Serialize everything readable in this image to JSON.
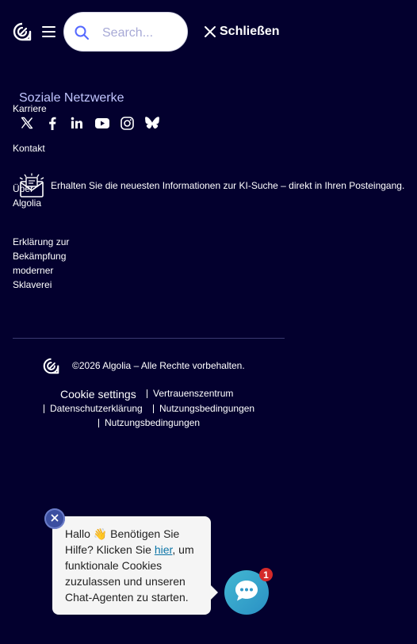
{
  "header": {
    "search_placeholder": "Search...",
    "close_label": "Schließen"
  },
  "menu": {
    "careers": "Karriere",
    "contact": "Kontakt",
    "about": "Über Algolia",
    "slavery_statement": "Erklärung zur Bekämpfung moderner Sklaverei"
  },
  "social": {
    "title": "Soziale Netzwerke",
    "icons": [
      "x-icon",
      "facebook-icon",
      "linkedin-icon",
      "youtube-icon",
      "instagram-icon",
      "bluesky-icon"
    ]
  },
  "newsletter": {
    "text": "Erhalten Sie die neuesten Informationen zur KI-Suche – direkt in Ihren Posteingang."
  },
  "footer": {
    "copyright": "©2026 Algolia – Alle Rechte vorbehalten.",
    "cookie_settings": "Cookie settings",
    "trust_center": "Vertrauenszentrum",
    "privacy": "Datenschutzerklärung",
    "terms_1": "Nutzungsbedingungen",
    "terms_2": "Nutzungsbedingungen"
  },
  "chat": {
    "greeting": "Hallo",
    "wave_emoji": "👋",
    "text_before_link": "Benötigen Sie Hilfe? Klicken Sie",
    "link_text": "hier",
    "text_after_link": ", um funktionale Cookies zuzulassen und unseren Chat-Agenten zu starten.",
    "badge_count": "1"
  },
  "colors": {
    "background": "#03002e",
    "social_title": "#c2c6ff",
    "chat_launcher": "#3aa6cf",
    "badge": "#d42929"
  }
}
